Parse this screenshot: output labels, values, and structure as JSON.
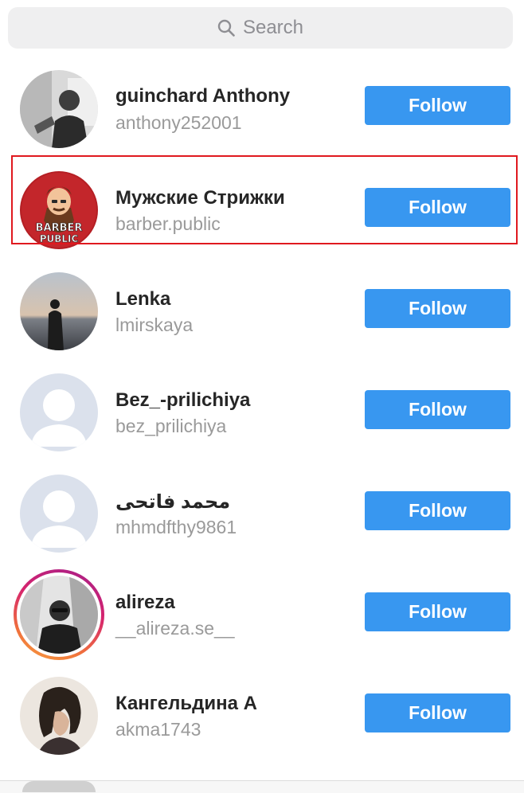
{
  "search": {
    "placeholder": "Search",
    "icon": "search-icon"
  },
  "button_color": "#3897f0",
  "highlight_color": "#e0191f",
  "users": [
    {
      "name": "guinchard Anthony",
      "username": "anthony252001",
      "follow_label": "Follow",
      "avatar": "photo-man-dark"
    },
    {
      "name": "Мужские Стрижки",
      "username": "barber.public",
      "follow_label": "Follow",
      "avatar": "barber-public-logo",
      "logo_text": "BARBER PUBLIC"
    },
    {
      "name": "Lenka",
      "username": "lmirskaya",
      "follow_label": "Follow",
      "avatar": "photo-silhouette-sea"
    },
    {
      "name": "Bez_-prilichiya",
      "username": "bez_prilichiya",
      "follow_label": "Follow",
      "avatar": "default-avatar-icon"
    },
    {
      "name": "محمد فاتحی",
      "username": "mhmdfthy9861",
      "follow_label": "Follow",
      "avatar": "default-avatar-icon"
    },
    {
      "name": "alireza",
      "username": "__alireza.se__",
      "follow_label": "Follow",
      "avatar": "photo-man-sunglasses",
      "story_ring": true
    },
    {
      "name": "Кангельдина А",
      "username": "akma1743",
      "follow_label": "Follow",
      "avatar": "photo-woman-bob"
    }
  ]
}
